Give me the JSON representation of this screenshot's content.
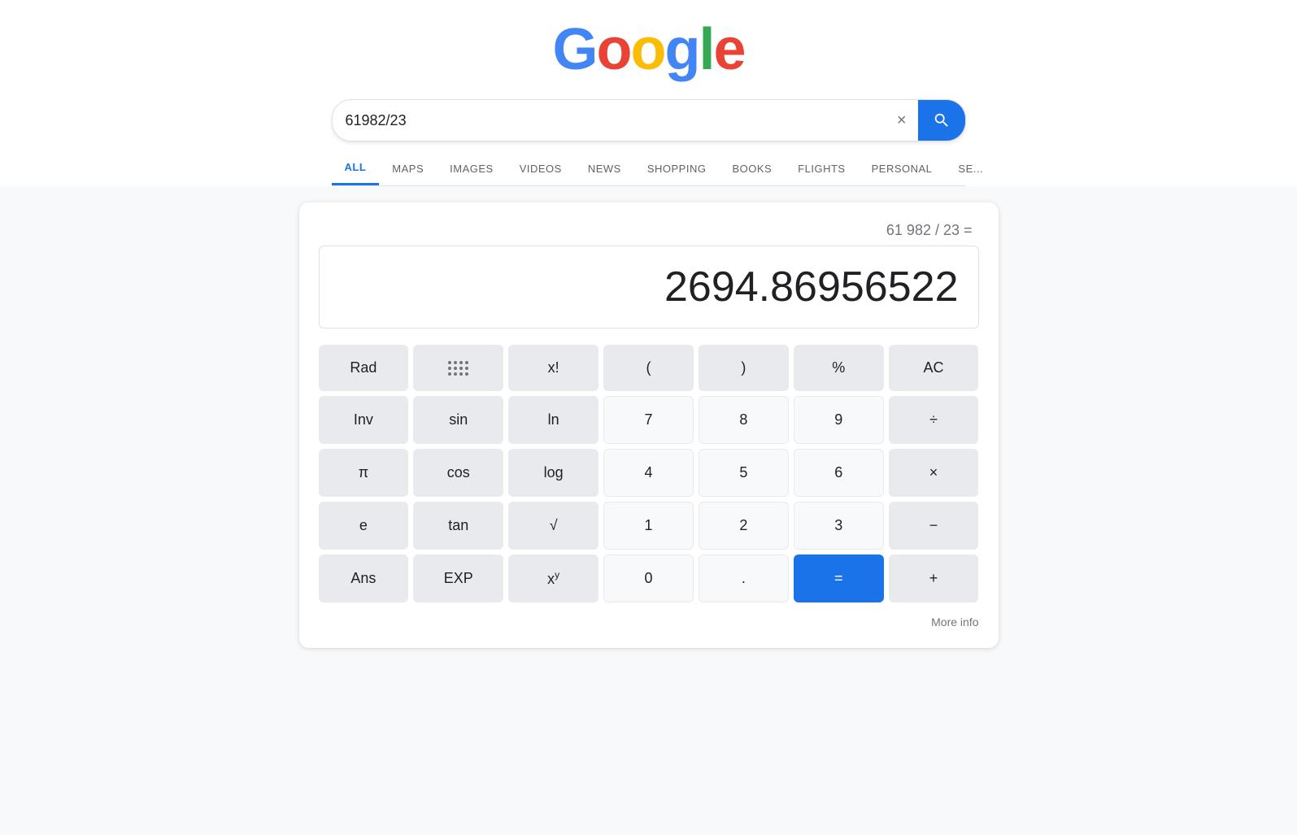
{
  "header": {
    "logo_letters": [
      {
        "char": "G",
        "color": "g-blue"
      },
      {
        "char": "o",
        "color": "g-red"
      },
      {
        "char": "o",
        "color": "g-yellow"
      },
      {
        "char": "g",
        "color": "g-blue"
      },
      {
        "char": "l",
        "color": "g-green"
      },
      {
        "char": "e",
        "color": "g-red"
      }
    ],
    "search_value": "61982/23",
    "clear_icon": "×",
    "search_icon": "search"
  },
  "nav": {
    "tabs": [
      {
        "label": "ALL",
        "active": true
      },
      {
        "label": "MAPS",
        "active": false
      },
      {
        "label": "IMAGES",
        "active": false
      },
      {
        "label": "VIDEOS",
        "active": false
      },
      {
        "label": "NEWS",
        "active": false
      },
      {
        "label": "SHOPPING",
        "active": false
      },
      {
        "label": "BOOKS",
        "active": false
      },
      {
        "label": "FLIGHTS",
        "active": false
      },
      {
        "label": "PERSONAL",
        "active": false
      },
      {
        "label": "SE...",
        "active": false
      }
    ]
  },
  "calculator": {
    "expression": "61 982 / 23 =",
    "result": "2694.86956522",
    "more_info_label": "More info",
    "buttons": [
      [
        {
          "label": "Rad",
          "type": "gray",
          "name": "rad-button"
        },
        {
          "label": "dots",
          "type": "dots",
          "name": "grid-button"
        },
        {
          "label": "x!",
          "type": "gray",
          "name": "factorial-button"
        },
        {
          "label": "(",
          "type": "gray",
          "name": "open-paren-button"
        },
        {
          "label": ")",
          "type": "gray",
          "name": "close-paren-button"
        },
        {
          "label": "%",
          "type": "gray",
          "name": "percent-button"
        },
        {
          "label": "AC",
          "type": "gray",
          "name": "ac-button"
        }
      ],
      [
        {
          "label": "Inv",
          "type": "gray",
          "name": "inv-button"
        },
        {
          "label": "sin",
          "type": "gray",
          "name": "sin-button"
        },
        {
          "label": "ln",
          "type": "gray",
          "name": "ln-button"
        },
        {
          "label": "7",
          "type": "white",
          "name": "seven-button"
        },
        {
          "label": "8",
          "type": "white",
          "name": "eight-button"
        },
        {
          "label": "9",
          "type": "white",
          "name": "nine-button"
        },
        {
          "label": "÷",
          "type": "gray",
          "name": "divide-button"
        }
      ],
      [
        {
          "label": "π",
          "type": "gray",
          "name": "pi-button"
        },
        {
          "label": "cos",
          "type": "gray",
          "name": "cos-button"
        },
        {
          "label": "log",
          "type": "gray",
          "name": "log-button"
        },
        {
          "label": "4",
          "type": "white",
          "name": "four-button"
        },
        {
          "label": "5",
          "type": "white",
          "name": "five-button"
        },
        {
          "label": "6",
          "type": "white",
          "name": "six-button"
        },
        {
          "label": "×",
          "type": "gray",
          "name": "multiply-button"
        }
      ],
      [
        {
          "label": "e",
          "type": "gray",
          "name": "euler-button"
        },
        {
          "label": "tan",
          "type": "gray",
          "name": "tan-button"
        },
        {
          "label": "√",
          "type": "gray",
          "name": "sqrt-button"
        },
        {
          "label": "1",
          "type": "white",
          "name": "one-button"
        },
        {
          "label": "2",
          "type": "white",
          "name": "two-button"
        },
        {
          "label": "3",
          "type": "white",
          "name": "three-button"
        },
        {
          "label": "−",
          "type": "gray",
          "name": "subtract-button"
        }
      ],
      [
        {
          "label": "Ans",
          "type": "gray",
          "name": "ans-button"
        },
        {
          "label": "EXP",
          "type": "gray",
          "name": "exp-button"
        },
        {
          "label": "xy",
          "type": "gray",
          "name": "power-button"
        },
        {
          "label": "0",
          "type": "white",
          "name": "zero-button"
        },
        {
          "label": ".",
          "type": "white",
          "name": "decimal-button"
        },
        {
          "label": "=",
          "type": "blue",
          "name": "equals-button"
        },
        {
          "label": "+",
          "type": "gray",
          "name": "add-button"
        }
      ]
    ]
  }
}
